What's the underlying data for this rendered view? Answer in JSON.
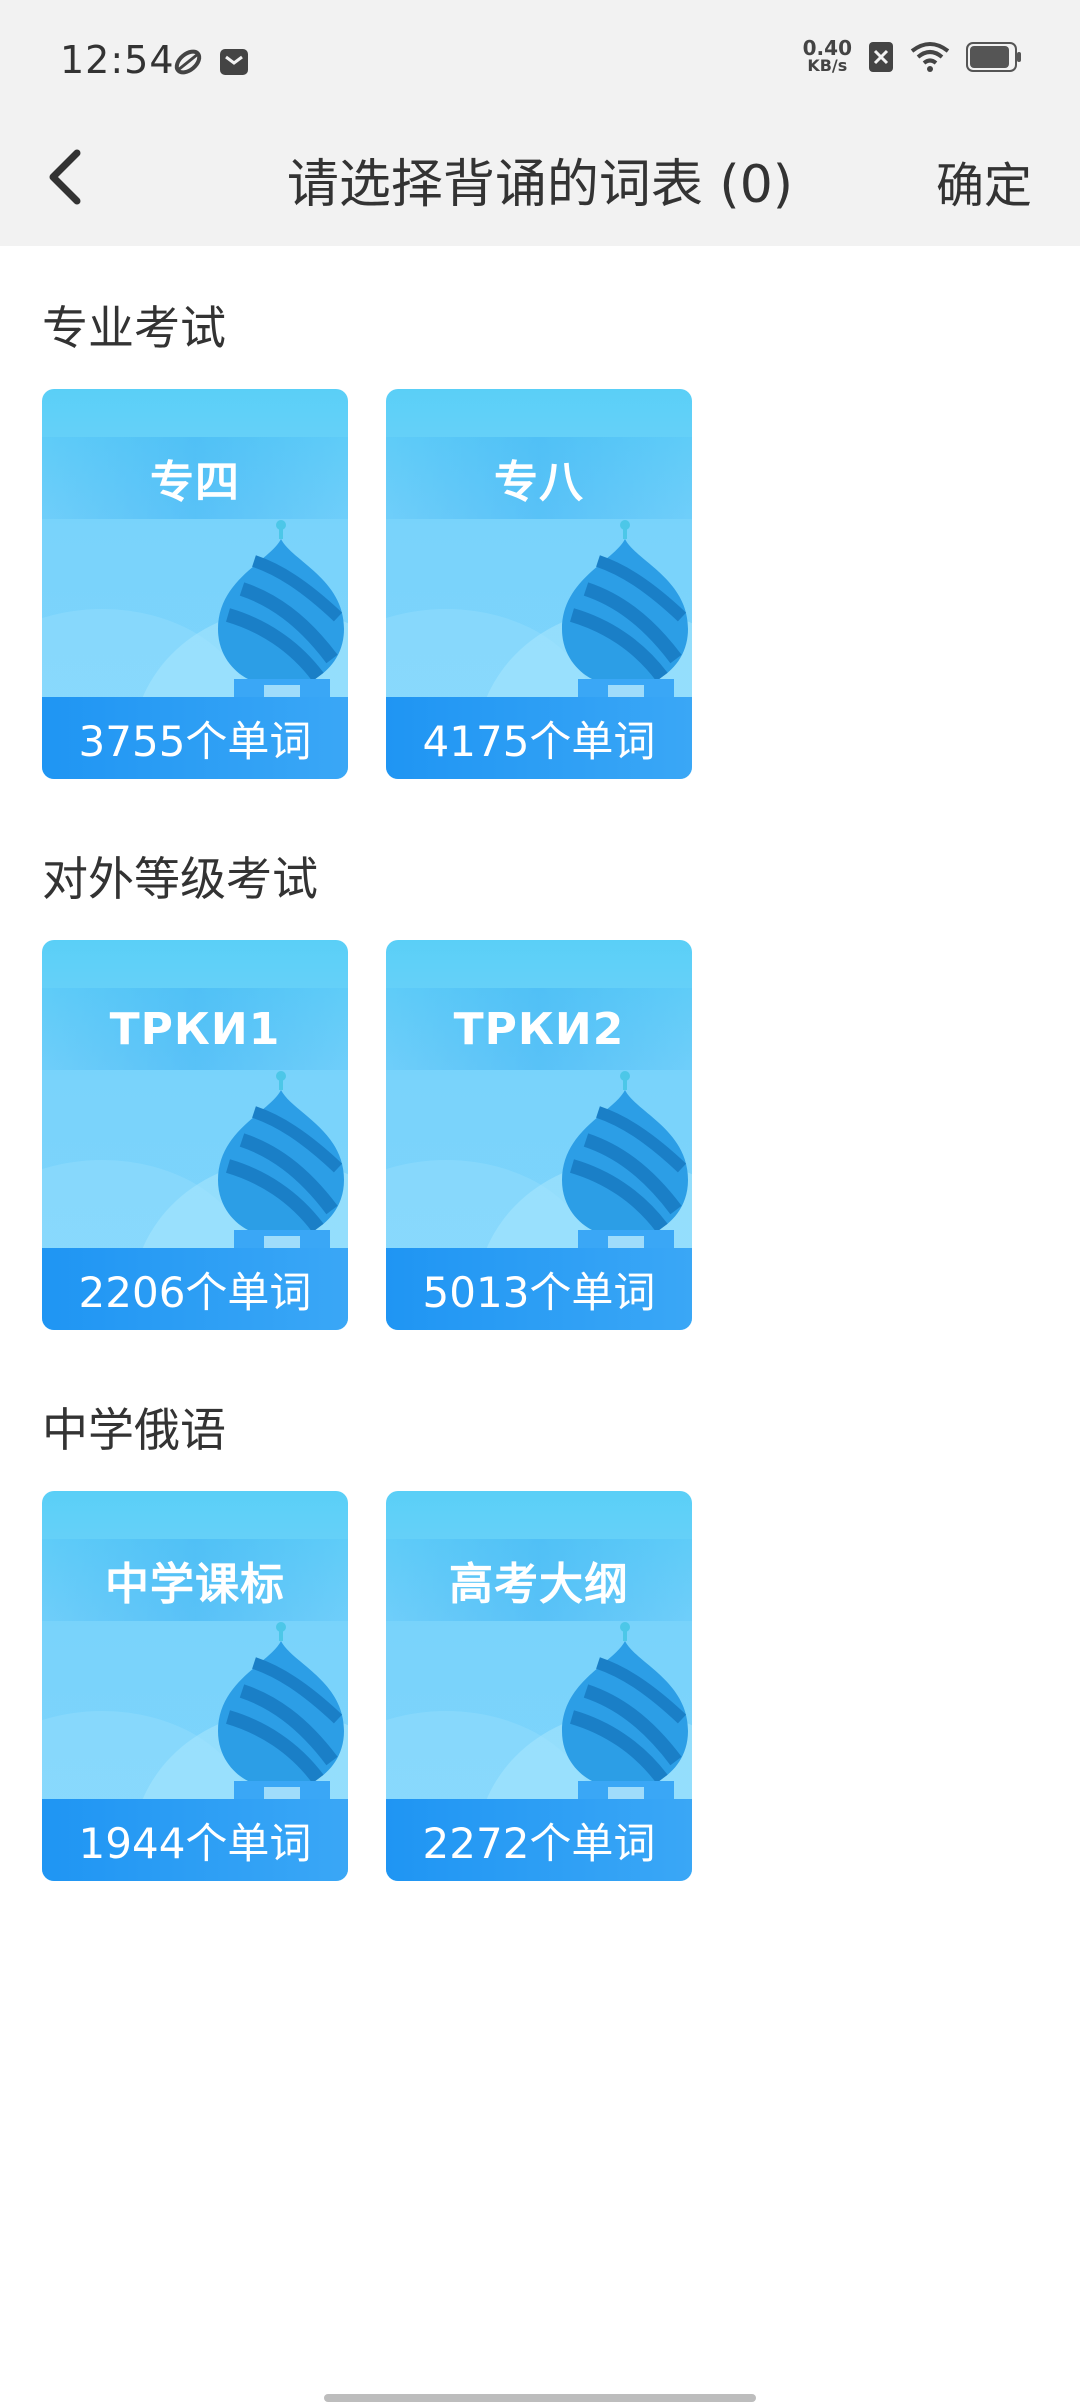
{
  "status_bar": {
    "time": "12:54",
    "net_speed_value": "0.40",
    "net_speed_unit": "KB/s",
    "battery_level": 0.9
  },
  "nav": {
    "title": "请选择背诵的词表 (0)",
    "confirm_label": "确定"
  },
  "sections": [
    {
      "title": "专业考试",
      "cards": [
        {
          "label": "专四",
          "count": "3755个单词"
        },
        {
          "label": "专八",
          "count": "4175个单词"
        }
      ]
    },
    {
      "title": "对外等级考试",
      "cards": [
        {
          "label": "ТРКИ1",
          "count": "2206个单词"
        },
        {
          "label": "ТРКИ2",
          "count": "5013个单词"
        }
      ]
    },
    {
      "title": "中学俄语",
      "cards": [
        {
          "label": "中学课标",
          "count": "1944个单词"
        },
        {
          "label": "高考大纲",
          "count": "2272个单词"
        }
      ]
    }
  ],
  "colors": {
    "header_bg": "#f2f2f2",
    "card_top": "#5acff7",
    "card_footer": "#1f95f3",
    "dome": "#2c9ee6",
    "dome_stripe": "#1a7fc7",
    "text_dark": "#333333"
  }
}
